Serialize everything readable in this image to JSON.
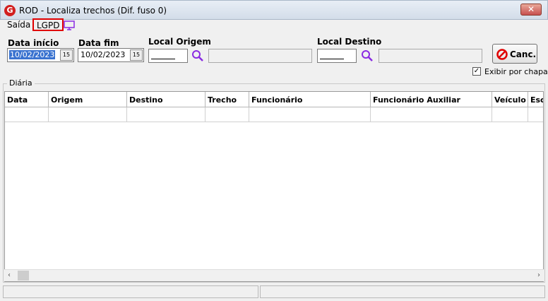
{
  "window": {
    "title": "ROD - Localiza trechos (Dif. fuso 0)",
    "close_label": "✕"
  },
  "menu": {
    "saida": "Saída",
    "lgpd": "LGPD"
  },
  "filters": {
    "data_inicio_label": "Data início",
    "data_inicio_value": "10/02/2023",
    "data_fim_label": "Data fim",
    "data_fim_value": "10/02/2023",
    "local_origem_label": "Local Origem",
    "local_destino_label": "Local Destino",
    "cal_label": "15"
  },
  "buttons": {
    "cancel_label": "Canc."
  },
  "options": {
    "exibir_por_chapa": "Exibir por chapa",
    "exibir_checked": "✓"
  },
  "group": {
    "label": "Diária"
  },
  "grid": {
    "columns": [
      "Data",
      "Origem",
      "Destino",
      "Trecho",
      "Funcionário",
      "Funcionário Auxiliar",
      "Veículo",
      "Esc"
    ]
  },
  "colors": {
    "accent": "#3a73d0",
    "highlight": "#e00000",
    "icon_purple": "#8a2be2"
  }
}
